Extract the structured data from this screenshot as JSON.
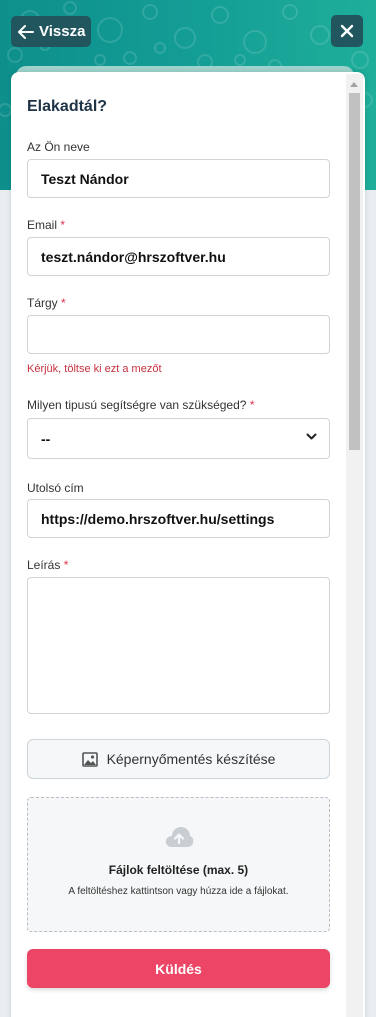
{
  "header": {
    "back_label": "Vissza",
    "back_icon": "arrow-left-icon",
    "close_icon": "close-icon",
    "gradient_colors": [
      "#0e8f8c",
      "#1fae9a"
    ]
  },
  "form": {
    "title": "Elakadtál?",
    "name_label": "Az Ön neve",
    "name_value": "Teszt Nándor",
    "email_label": "Email",
    "email_value": "teszt.nándor@hrszoftver.hu",
    "subject_label": "Tárgy",
    "subject_value": "",
    "subject_error": "Kérjük, töltse ki ezt a mezőt",
    "help_type_label": "Milyen tipusú segítségre van szükséged?",
    "help_type_value": "--",
    "last_url_label": "Utolsó cím",
    "last_url_value": "https://demo.hrszoftver.hu/settings",
    "description_label": "Leírás",
    "description_value": "",
    "required_mark": "*",
    "screenshot_label": "Képernyőmentés készítése",
    "upload_title": "Fájlok feltöltése (max. 5)",
    "upload_hint": "A feltöltéshez kattintson vagy húzza ide a fájlokat.",
    "submit_label": "Küldés"
  },
  "colors": {
    "accent": "#ed4566",
    "header_button": "#21565f",
    "error": "#c8313f"
  }
}
